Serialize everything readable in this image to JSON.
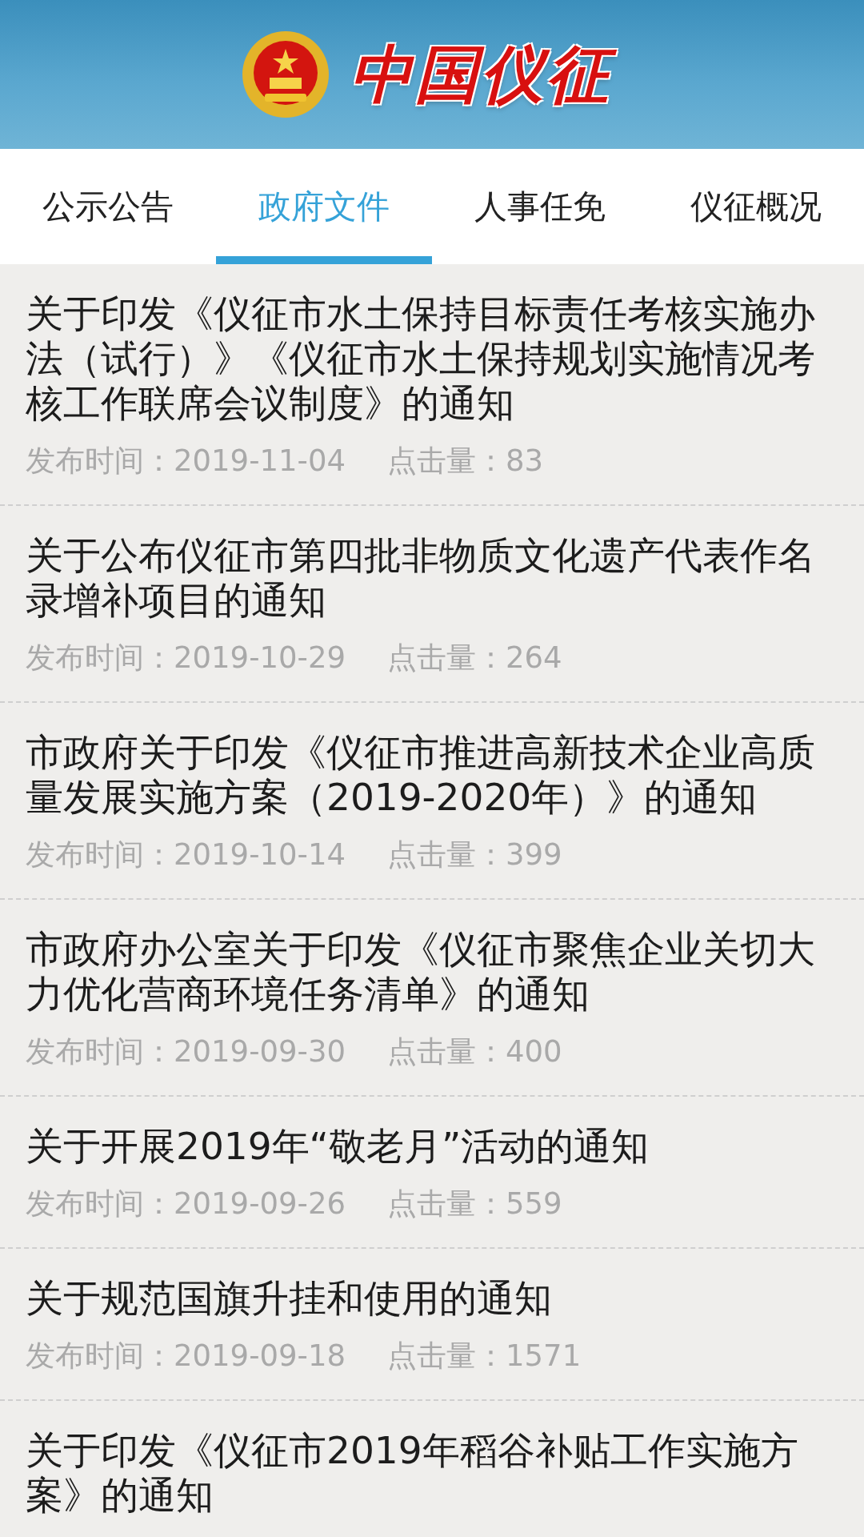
{
  "header": {
    "logo_text": "中国仪征"
  },
  "tabs": [
    {
      "label": "公示公告",
      "selected": false
    },
    {
      "label": "政府文件",
      "selected": true
    },
    {
      "label": "人事任免",
      "selected": false
    },
    {
      "label": "仪征概况",
      "selected": false
    }
  ],
  "articles": [
    {
      "title": "关于印发《仪征市水土保持目标责任考核实施办法（试行）》《仪征市水土保持规划实施情况考核工作联席会议制度》的通知",
      "date": "发布时间：2019-11-04",
      "views": "点击量：83"
    },
    {
      "title": "关于公布仪征市第四批非物质文化遗产代表作名录增补项目的通知",
      "date": "发布时间：2019-10-29",
      "views": "点击量：264"
    },
    {
      "title": "市政府关于印发《仪征市推进高新技术企业高质量发展实施方案（2019-2020年）》的通知",
      "date": "发布时间：2019-10-14",
      "views": "点击量：399"
    },
    {
      "title": "市政府办公室关于印发《仪征市聚焦企业关切大力优化营商环境任务清单》的通知",
      "date": "发布时间：2019-09-30",
      "views": "点击量：400"
    },
    {
      "title": "关于开展2019年“敬老月”活动的通知",
      "date": "发布时间：2019-09-26",
      "views": "点击量：559"
    },
    {
      "title": "关于规范国旗升挂和使用的通知",
      "date": "发布时间：2019-09-18",
      "views": "点击量：1571"
    },
    {
      "title": "关于印发《仪征市2019年稻谷补贴工作实施方案》的通知"
    }
  ]
}
